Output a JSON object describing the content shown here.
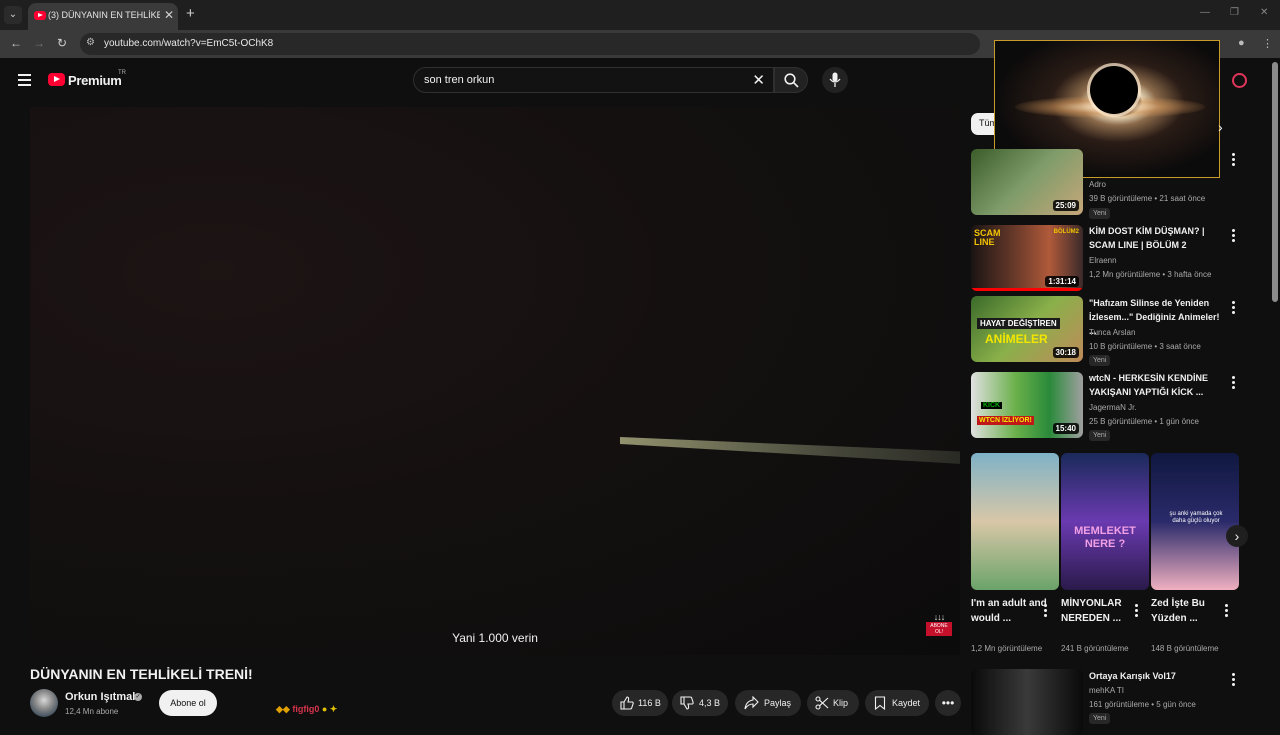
{
  "browser": {
    "tab_title": "(3) DÜNYANIN EN TEHLİKELİ TRENİ!",
    "url": "youtube.com/watch?v=EmC5t-OChK8"
  },
  "header": {
    "brand": "Premium",
    "region": "TR",
    "search_query": "son tren orkun"
  },
  "player": {
    "subtitle": "Yani 1.000 verin",
    "badge_text": "ABONE OL!"
  },
  "video": {
    "title": "DÜNYANIN EN TEHLİKELİ TRENİ!",
    "channel": "Orkun Işıtmak",
    "subscribers": "12,4 Mn abone",
    "subscribe_label": "Abone ol",
    "chat_user": "figfig0",
    "likes": "116 B",
    "dislikes": "4,3 B",
    "share_label": "Paylaş",
    "clip_label": "Klip",
    "save_label": "Kaydet"
  },
  "sidebar": {
    "chip": "Tüm",
    "videos": [
      {
        "title": "",
        "channel": "Adro",
        "meta": "39 B görüntüleme • 21 saat önce",
        "badge": "Yeni",
        "duration": "25:09"
      },
      {
        "title": "KİM DOST KİM DÜŞMAN? | SCAM LINE | BÖLÜM 2",
        "channel": "Elraenn",
        "meta": "1,2 Mn görüntüleme • 3 hafta önce",
        "badge": "",
        "duration": "1:31:14"
      },
      {
        "title": "\"Hafızam Silinse de Yeniden İzlesem...\" Dediğiniz Animeler! ...",
        "channel": "Tunca Arslan",
        "meta": "10 B görüntüleme • 3 saat önce",
        "badge": "Yeni",
        "duration": "30:18"
      },
      {
        "title": "wtcN - HERKESİN KENDİNE YAKIŞANI YAPTIĞI KİCK ...",
        "channel": "JagermaN Jr.",
        "meta": "25 B görüntüleme • 1 gün önce",
        "badge": "Yeni",
        "duration": "15:40"
      },
      {
        "title": "Ortaya Karışık Vol17",
        "channel": "mehKA TI",
        "meta": "161 görüntüleme • 5 gün önce",
        "badge": "Yeni",
        "duration": ""
      }
    ],
    "thumb_texts": {
      "scam": "SCAM LINE",
      "bolum": "BÖLÜM2",
      "hayat1": "HAYAT DEĞİŞTİREN",
      "hayat2": "ANİMELER",
      "kick1": "KICK",
      "kick2": "WTCN İZLİYOR!"
    },
    "shorts": [
      {
        "title": "I'm an adult and would ...",
        "views": "1,2 Mn görüntüleme"
      },
      {
        "title": "MİNYONLAR NEREDEN ...",
        "views": "241 B görüntüleme",
        "overlay": "MEMLEKET NERE ?"
      },
      {
        "title": "Zed İşte Bu Yüzden ...",
        "views": "148 B görüntüleme",
        "overlay": "şu anki yamada çok daha güçlü oluyor"
      }
    ]
  },
  "colors": {
    "accent": "#ff0033",
    "background": "#0f0f0f",
    "progress": "#ff0000"
  }
}
